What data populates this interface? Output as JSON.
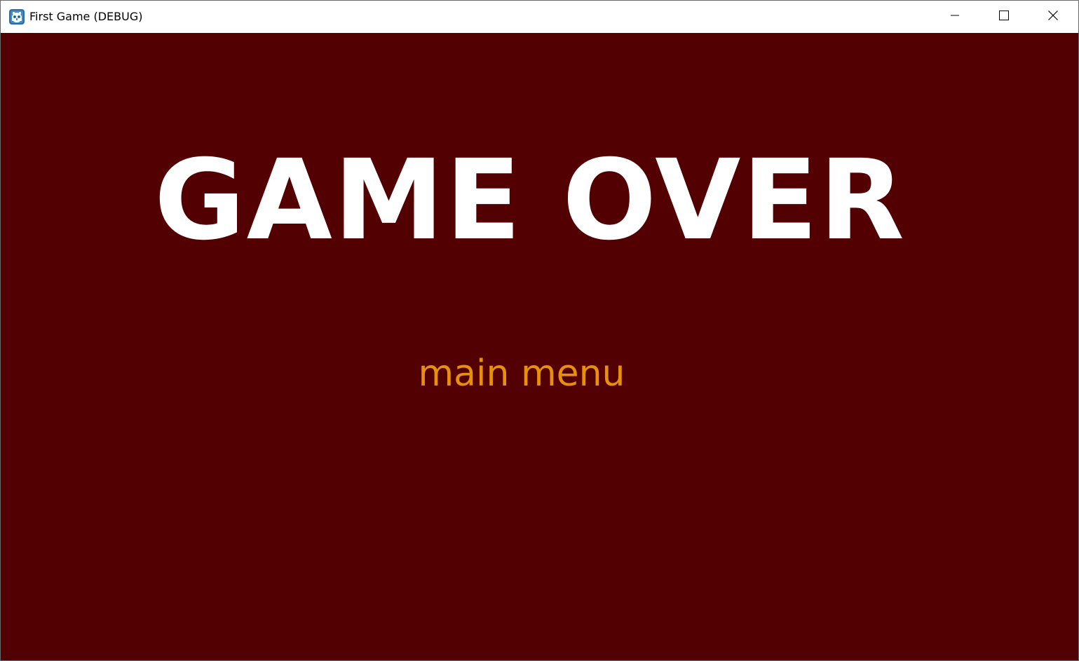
{
  "window": {
    "title": "First Game (DEBUG)",
    "app_icon": "godot-engine-icon",
    "controls": {
      "minimize_icon": "minimize-icon",
      "maximize_icon": "maximize-icon",
      "close_icon": "close-icon"
    }
  },
  "game": {
    "background_color": "#530003",
    "title": "GAME OVER",
    "title_color": "#ffffff",
    "menu_button": "main menu",
    "menu_button_color": "#e7900c"
  }
}
